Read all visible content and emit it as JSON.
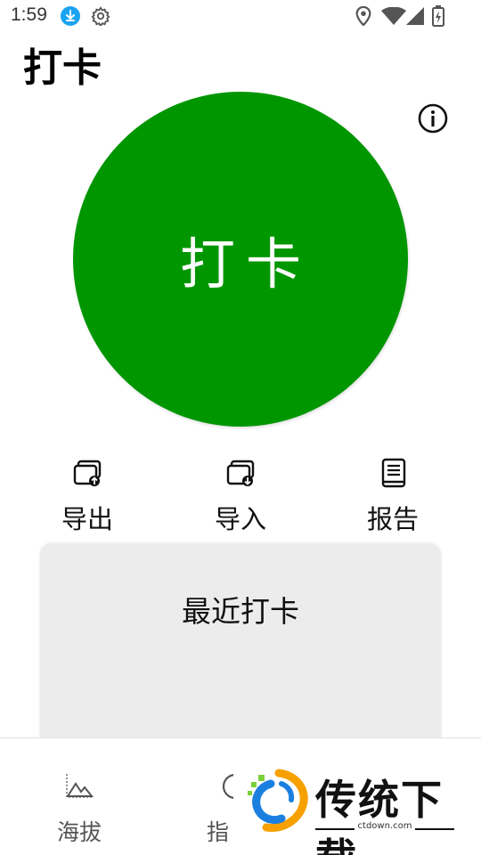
{
  "status_bar": {
    "time": "1:59",
    "icons": [
      "download-icon",
      "settings-icon",
      "location-icon",
      "wifi-icon",
      "signal-icon",
      "battery-icon"
    ],
    "download_color": "#1aa3f0"
  },
  "header": {
    "title": "打卡"
  },
  "checkin": {
    "label": "打卡",
    "color": "#009600"
  },
  "actions": [
    {
      "label": "导出",
      "icon": "export-icon"
    },
    {
      "label": "导入",
      "icon": "import-icon"
    },
    {
      "label": "报告",
      "icon": "report-icon"
    }
  ],
  "recent": {
    "title": "最近打卡",
    "background": "#ececec"
  },
  "bottom_nav": [
    {
      "label": "海拔",
      "icon": "mountain-icon"
    },
    {
      "label": "指",
      "icon": "compass-icon"
    }
  ],
  "watermark": {
    "text": "传统下载",
    "url": "ctdown.com"
  }
}
